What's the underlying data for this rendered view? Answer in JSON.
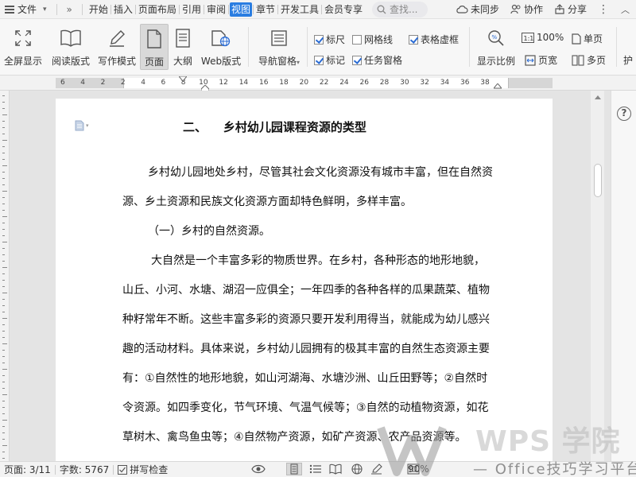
{
  "menubar": {
    "file_label": "文件",
    "more_label": "»",
    "tabs": [
      "开始",
      "插入",
      "页面布局",
      "引用",
      "审阅",
      "视图",
      "章节",
      "开发工具",
      "会员专享"
    ],
    "active_tab": "视图",
    "search_placeholder": "查找...",
    "unsync_label": "未同步",
    "collab_label": "协作",
    "share_label": "分享",
    "more_dots": "⋮"
  },
  "ribbon": {
    "fullscreen": "全屏显示",
    "reading": "阅读版式",
    "writing": "写作模式",
    "page": "页面",
    "outline": "大纲",
    "web": "Web版式",
    "nav_pane": "导航窗格",
    "ruler": "标尺",
    "gridlines": "网格线",
    "table_gridlines": "表格虚框",
    "marks": "标记",
    "task_pane": "任务窗格",
    "zoom_ratio": "显示比例",
    "zoom_100": "100%",
    "page_width": "页宽",
    "single_page": "单页",
    "multi_page": "多页",
    "cut_off": "护",
    "checks": {
      "ruler": true,
      "gridlines": false,
      "table_gridlines": true,
      "marks": true,
      "task_pane": true
    }
  },
  "ruler": {
    "labels": [
      "6",
      "4",
      "2",
      "2",
      "4",
      "6",
      "8",
      "10",
      "12",
      "14",
      "16",
      "18",
      "20",
      "22",
      "24",
      "26",
      "28",
      "30",
      "32",
      "34",
      "36",
      "38"
    ]
  },
  "document": {
    "heading": "二、    乡村幼儿园课程资源的类型",
    "lines": [
      "乡村幼儿园地处乡村，尽管其社会文化资源没有城市丰富，但在自然资",
      "源、乡土资源和民族文化资源方面却特色鲜明，多样丰富。",
      "（一）乡村的自然资源。",
      "大自然是一个丰富多彩的物质世界。在乡村，各种形态的地形地貌，",
      "山丘、小河、水塘、湖沼一应俱全；一年四季的各种各样的瓜果蔬菜、植物",
      "种籽常年不断。这些丰富多彩的资源只要开发利用得当，就能成为幼儿感兴",
      "趣的活动材料。具体来说，乡村幼儿园拥有的极其丰富的自然生态资源主要",
      "有：①自然性的地形地貌，如山河湖海、水塘沙洲、山丘田野等；②自然时",
      "令资源。如四季变化，节气环境、气温气候等；③自然的动植物资源，如花",
      "草树木、禽鸟鱼虫等；④自然物产资源，如矿产资源、农产品资源等。"
    ]
  },
  "statusbar": {
    "page": "页面: 3/11",
    "words": "字数: 5767",
    "spellcheck": "拼写检查",
    "zoom": "90%"
  },
  "watermark": {
    "brand": "WPS 学院",
    "slogan": "— Office技巧学习平台"
  }
}
